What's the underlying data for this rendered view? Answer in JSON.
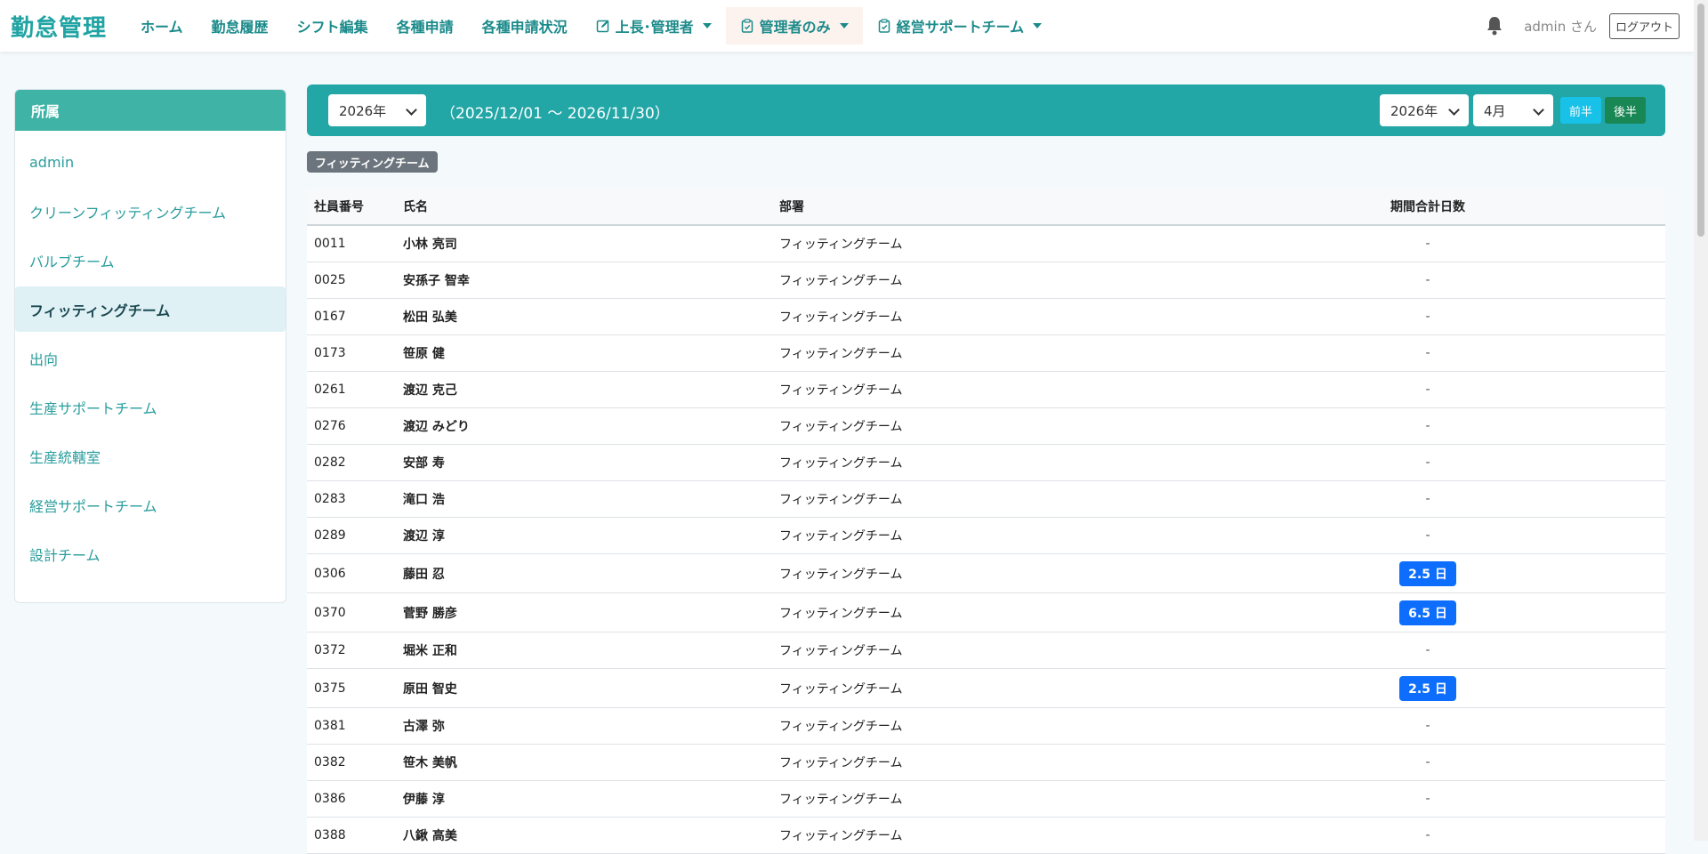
{
  "brand": "勤怠管理",
  "nav": {
    "items": [
      {
        "label": "ホーム"
      },
      {
        "label": "勤怠履歴"
      },
      {
        "label": "シフト編集"
      },
      {
        "label": "各種申請"
      },
      {
        "label": "各種申請状況"
      },
      {
        "label": "上長･管理者",
        "icon": "edit-icon",
        "dropdown": true
      },
      {
        "label": "管理者のみ",
        "icon": "clipboard-icon",
        "dropdown": true,
        "active": true
      },
      {
        "label": "経営サポートチーム",
        "icon": "clipboard-icon",
        "dropdown": true
      }
    ],
    "user_label": "admin さん",
    "logout_label": "ログアウト"
  },
  "sidebar": {
    "title": "所属",
    "items": [
      {
        "label": "admin"
      },
      {
        "label": "クリーンフィッティングチーム"
      },
      {
        "label": "バルブチーム"
      },
      {
        "label": "フィッティングチーム",
        "active": true
      },
      {
        "label": "出向"
      },
      {
        "label": "生産サポートチーム"
      },
      {
        "label": "生産統轄室"
      },
      {
        "label": "経営サポートチーム"
      },
      {
        "label": "設計チーム"
      }
    ]
  },
  "toolbar": {
    "fiscal_year": "2026年",
    "period": "（2025/12/01 〜 2026/11/30）",
    "year": "2026年",
    "month": "4月",
    "first_half_label": "前半",
    "second_half_label": "後半"
  },
  "team_badge": "フィッティングチーム",
  "table": {
    "headers": [
      "社員番号",
      "氏名",
      "部署",
      "期間合計日数"
    ],
    "rows": [
      {
        "id": "0011",
        "name": "小林 亮司",
        "dept": "フィッティングチーム",
        "days": "-"
      },
      {
        "id": "0025",
        "name": "安孫子 智幸",
        "dept": "フィッティングチーム",
        "days": "-"
      },
      {
        "id": "0167",
        "name": "松田 弘美",
        "dept": "フィッティングチーム",
        "days": "-"
      },
      {
        "id": "0173",
        "name": "笹原 健",
        "dept": "フィッティングチーム",
        "days": "-"
      },
      {
        "id": "0261",
        "name": "渡辺 克己",
        "dept": "フィッティングチーム",
        "days": "-"
      },
      {
        "id": "0276",
        "name": "渡辺 みどり",
        "dept": "フィッティングチーム",
        "days": "-"
      },
      {
        "id": "0282",
        "name": "安部 寿",
        "dept": "フィッティングチーム",
        "days": "-"
      },
      {
        "id": "0283",
        "name": "滝口 浩",
        "dept": "フィッティングチーム",
        "days": "-"
      },
      {
        "id": "0289",
        "name": "渡辺 淳",
        "dept": "フィッティングチーム",
        "days": "-"
      },
      {
        "id": "0306",
        "name": "藤田 忍",
        "dept": "フィッティングチーム",
        "days": "2.5 日"
      },
      {
        "id": "0370",
        "name": "菅野 勝彦",
        "dept": "フィッティングチーム",
        "days": "6.5 日"
      },
      {
        "id": "0372",
        "name": "堀米 正和",
        "dept": "フィッティングチーム",
        "days": "-"
      },
      {
        "id": "0375",
        "name": "原田 智史",
        "dept": "フィッティングチーム",
        "days": "2.5 日"
      },
      {
        "id": "0381",
        "name": "古澤 弥",
        "dept": "フィッティングチーム",
        "days": "-"
      },
      {
        "id": "0382",
        "name": "笹木 美帆",
        "dept": "フィッティングチーム",
        "days": "-"
      },
      {
        "id": "0386",
        "name": "伊藤 淳",
        "dept": "フィッティングチーム",
        "days": "-"
      },
      {
        "id": "0388",
        "name": "八鍬 高美",
        "dept": "フィッティングチーム",
        "days": "-"
      }
    ]
  },
  "colors": {
    "accent": "#22a6a6",
    "sidebar_header": "#3fb3a6",
    "badge": "#0d6efd",
    "first_half": "#17c1e8",
    "second_half": "#198754"
  }
}
